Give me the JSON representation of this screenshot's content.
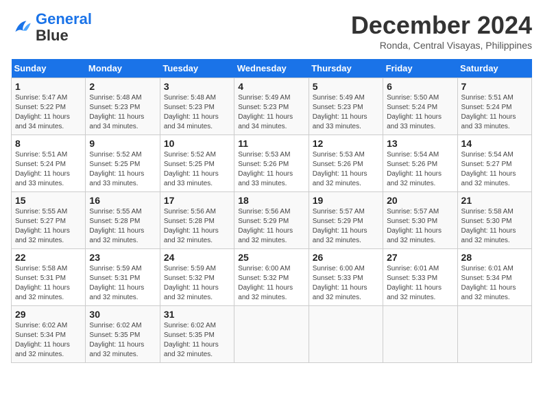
{
  "header": {
    "logo_line1": "General",
    "logo_line2": "Blue",
    "month": "December 2024",
    "location": "Ronda, Central Visayas, Philippines"
  },
  "days_of_week": [
    "Sunday",
    "Monday",
    "Tuesday",
    "Wednesday",
    "Thursday",
    "Friday",
    "Saturday"
  ],
  "weeks": [
    [
      {
        "day": 1,
        "info": "Sunrise: 5:47 AM\nSunset: 5:22 PM\nDaylight: 11 hours\nand 34 minutes."
      },
      {
        "day": 2,
        "info": "Sunrise: 5:48 AM\nSunset: 5:23 PM\nDaylight: 11 hours\nand 34 minutes."
      },
      {
        "day": 3,
        "info": "Sunrise: 5:48 AM\nSunset: 5:23 PM\nDaylight: 11 hours\nand 34 minutes."
      },
      {
        "day": 4,
        "info": "Sunrise: 5:49 AM\nSunset: 5:23 PM\nDaylight: 11 hours\nand 34 minutes."
      },
      {
        "day": 5,
        "info": "Sunrise: 5:49 AM\nSunset: 5:23 PM\nDaylight: 11 hours\nand 33 minutes."
      },
      {
        "day": 6,
        "info": "Sunrise: 5:50 AM\nSunset: 5:24 PM\nDaylight: 11 hours\nand 33 minutes."
      },
      {
        "day": 7,
        "info": "Sunrise: 5:51 AM\nSunset: 5:24 PM\nDaylight: 11 hours\nand 33 minutes."
      }
    ],
    [
      {
        "day": 8,
        "info": "Sunrise: 5:51 AM\nSunset: 5:24 PM\nDaylight: 11 hours\nand 33 minutes."
      },
      {
        "day": 9,
        "info": "Sunrise: 5:52 AM\nSunset: 5:25 PM\nDaylight: 11 hours\nand 33 minutes."
      },
      {
        "day": 10,
        "info": "Sunrise: 5:52 AM\nSunset: 5:25 PM\nDaylight: 11 hours\nand 33 minutes."
      },
      {
        "day": 11,
        "info": "Sunrise: 5:53 AM\nSunset: 5:26 PM\nDaylight: 11 hours\nand 33 minutes."
      },
      {
        "day": 12,
        "info": "Sunrise: 5:53 AM\nSunset: 5:26 PM\nDaylight: 11 hours\nand 32 minutes."
      },
      {
        "day": 13,
        "info": "Sunrise: 5:54 AM\nSunset: 5:26 PM\nDaylight: 11 hours\nand 32 minutes."
      },
      {
        "day": 14,
        "info": "Sunrise: 5:54 AM\nSunset: 5:27 PM\nDaylight: 11 hours\nand 32 minutes."
      }
    ],
    [
      {
        "day": 15,
        "info": "Sunrise: 5:55 AM\nSunset: 5:27 PM\nDaylight: 11 hours\nand 32 minutes."
      },
      {
        "day": 16,
        "info": "Sunrise: 5:55 AM\nSunset: 5:28 PM\nDaylight: 11 hours\nand 32 minutes."
      },
      {
        "day": 17,
        "info": "Sunrise: 5:56 AM\nSunset: 5:28 PM\nDaylight: 11 hours\nand 32 minutes."
      },
      {
        "day": 18,
        "info": "Sunrise: 5:56 AM\nSunset: 5:29 PM\nDaylight: 11 hours\nand 32 minutes."
      },
      {
        "day": 19,
        "info": "Sunrise: 5:57 AM\nSunset: 5:29 PM\nDaylight: 11 hours\nand 32 minutes."
      },
      {
        "day": 20,
        "info": "Sunrise: 5:57 AM\nSunset: 5:30 PM\nDaylight: 11 hours\nand 32 minutes."
      },
      {
        "day": 21,
        "info": "Sunrise: 5:58 AM\nSunset: 5:30 PM\nDaylight: 11 hours\nand 32 minutes."
      }
    ],
    [
      {
        "day": 22,
        "info": "Sunrise: 5:58 AM\nSunset: 5:31 PM\nDaylight: 11 hours\nand 32 minutes."
      },
      {
        "day": 23,
        "info": "Sunrise: 5:59 AM\nSunset: 5:31 PM\nDaylight: 11 hours\nand 32 minutes."
      },
      {
        "day": 24,
        "info": "Sunrise: 5:59 AM\nSunset: 5:32 PM\nDaylight: 11 hours\nand 32 minutes."
      },
      {
        "day": 25,
        "info": "Sunrise: 6:00 AM\nSunset: 5:32 PM\nDaylight: 11 hours\nand 32 minutes."
      },
      {
        "day": 26,
        "info": "Sunrise: 6:00 AM\nSunset: 5:33 PM\nDaylight: 11 hours\nand 32 minutes."
      },
      {
        "day": 27,
        "info": "Sunrise: 6:01 AM\nSunset: 5:33 PM\nDaylight: 11 hours\nand 32 minutes."
      },
      {
        "day": 28,
        "info": "Sunrise: 6:01 AM\nSunset: 5:34 PM\nDaylight: 11 hours\nand 32 minutes."
      }
    ],
    [
      {
        "day": 29,
        "info": "Sunrise: 6:02 AM\nSunset: 5:34 PM\nDaylight: 11 hours\nand 32 minutes."
      },
      {
        "day": 30,
        "info": "Sunrise: 6:02 AM\nSunset: 5:35 PM\nDaylight: 11 hours\nand 32 minutes."
      },
      {
        "day": 31,
        "info": "Sunrise: 6:02 AM\nSunset: 5:35 PM\nDaylight: 11 hours\nand 32 minutes."
      },
      null,
      null,
      null,
      null
    ]
  ]
}
